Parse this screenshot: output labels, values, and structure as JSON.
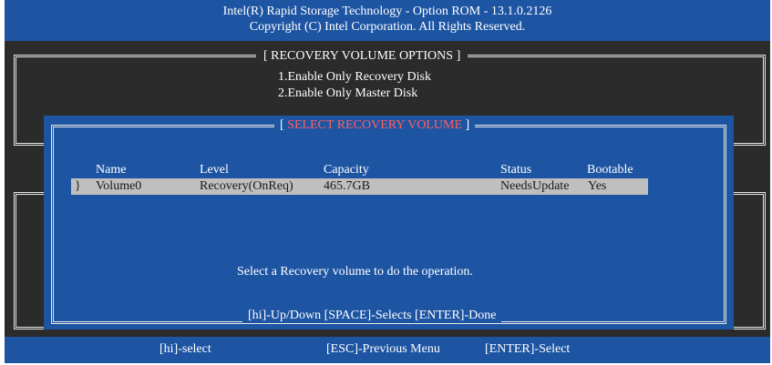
{
  "header": {
    "line1": "Intel(R) Rapid Storage Technology - Option ROM - 13.1.0.2126",
    "line2": "Copyright (C)  Intel Corporation.   All Rights Reserved."
  },
  "options_panel": {
    "title": "[ RECOVERY VOLUME OPTIONS ]",
    "items": [
      "1.Enable Only Recovery Disk",
      "2.Enable Only Master Disk"
    ]
  },
  "dialog": {
    "title_open": "[ ",
    "title": "SELECT RECOVERY VOLUME",
    "title_close": " ]",
    "columns": [
      "Name",
      "Level",
      "Capacity",
      "Status",
      "Bootable"
    ],
    "rows": [
      {
        "cursor": "}",
        "name": "Volume0",
        "level": "Recovery(OnReq)",
        "capacity": "465.7GB",
        "status": "NeedsUpdate",
        "bootable": "Yes"
      }
    ],
    "message": "Select a Recovery volume to do the operation.",
    "keys": "[hi]-Up/Down   [SPACE]-Selects  [ENTER]-Done"
  },
  "footer": {
    "select": "[hi]-select",
    "previous": "[ESC]-Previous Menu",
    "enter": "[ENTER]-Select"
  },
  "colors": {
    "blue": "#1e55a3",
    "dark": "#2b2b2b",
    "highlight_title": "#ff6060",
    "selection_bar": "#bfbfbf",
    "cursor": "#2ca82c"
  }
}
